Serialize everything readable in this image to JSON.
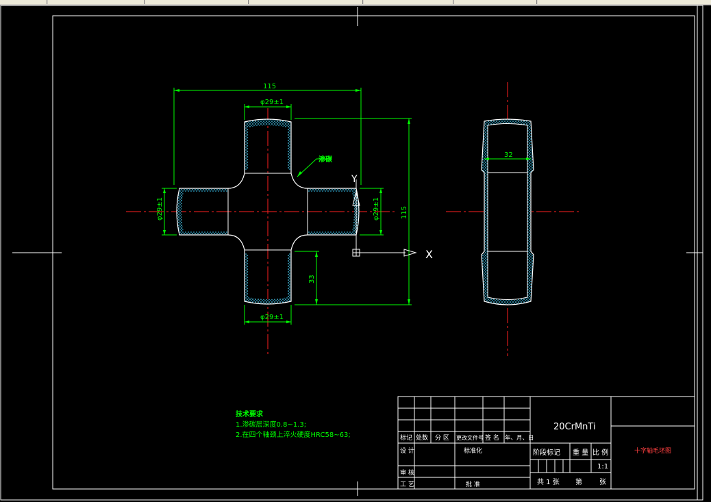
{
  "drawing": {
    "dims": {
      "overall_width": "115",
      "top_diameter": "φ29±1",
      "bottom_diameter": "φ29±1",
      "left_diameter": "φ29±1",
      "right_diameter": "φ29±1",
      "overall_height": "115",
      "arm_length": "33",
      "side_width": "32"
    },
    "callout": "渗碳",
    "ucs": {
      "y": "Y",
      "x": "X"
    }
  },
  "notes": {
    "title": "技术要求",
    "line1": "1.渗碳层深度0.8~1.3;",
    "line2": "2.在四个轴颈上淬火硬度HRC58~63;"
  },
  "title_block": {
    "material": "20CrMnTi",
    "drawing_name": "十字轴毛坯图",
    "scale": "1:1",
    "headers": [
      "标记",
      "处数",
      "分 区",
      "更改文件号",
      "签 名",
      "年、月、日"
    ],
    "design": "设 计",
    "standardize": "标准化",
    "review": "审 核",
    "process": "工 艺",
    "approve": "批 准",
    "stage_mark": "阶段标记",
    "weight": "重 量",
    "ratio": "比 例",
    "sheets_total": "共 1 张",
    "sheet_no": "第",
    "sheet_suffix": "张"
  },
  "colors": {
    "border": "#ffffff",
    "outline": "#ffffff",
    "dimension": "#00ff00",
    "centerline": "#ff0000",
    "hatch": "#00c8ff"
  }
}
